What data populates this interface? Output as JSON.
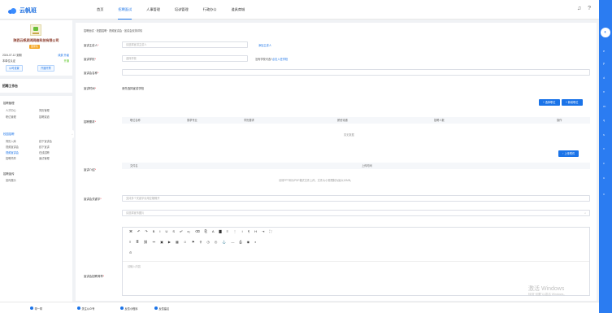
{
  "app": {
    "logo_text": "云帆班"
  },
  "nav": {
    "items": [
      "首页",
      "招聘面试",
      "人事管理",
      "培训管理",
      "行政办公",
      "道具商城"
    ]
  },
  "sidebar": {
    "company_name": "陕西云帆润鸿网络科技有限公司",
    "tag": "国家队",
    "date": "2024-07-12 到期",
    "date_actions": "续费 升级",
    "unit": "本单位认证",
    "unit_status": "开通",
    "btn_company": "公司设置",
    "btn_open": "开通开票",
    "workbench": "招聘工作台",
    "groups": [
      {
        "title": "招聘管理",
        "items": [
          "人才中心",
          "简历管理",
          "职位管理",
          "招聘渠道"
        ]
      },
      {
        "title": "校园招聘",
        "items": [
          "简历入库",
          "线下宣讲会",
          "视频宣讲会",
          "线下宣讲",
          "视频宣讲会",
          "在线招聘",
          "招聘简章",
          "面试管理"
        ]
      },
      {
        "title": "招聘宣传",
        "items": [
          "宣传展示"
        ]
      }
    ]
  },
  "main": {
    "breadcrumb": "招聘面试 · 校园招聘 · 视频宣讲会 · 宣讲会安排详情",
    "fields": {
      "host_label": "宣讲主讲人",
      "host_placeholder": "请选择宣讲主讲人",
      "host_link": "添加主讲人",
      "school_label": "宣讲学校",
      "school_placeholder": "选择学校",
      "school_hint": "没有学校可选?",
      "school_hint_link": "点击入驻学校",
      "name_label": "宣讲会名称",
      "time_label": "宣讲时间",
      "time_value": "请先选择宣讲学校",
      "recruit_label": "招聘需求",
      "intro_label": "宣讲介绍",
      "material_label": "宣讲会关键字",
      "material_placeholder": "支持多个关键字请用空格隔开",
      "attach_placeholder": "请选择宣传图片",
      "detail_label": "宣讲会招聘简章",
      "editor_placeholder": "请输入内容"
    },
    "buttons": {
      "choose": "+ 选择职位",
      "add": "+ 新增职位",
      "upload": "↑ 上传附件"
    },
    "recruit_table": {
      "columns": [
        "职位名称",
        "需求专业",
        "学历要求",
        "薪资待遇",
        "招聘人数",
        "操作"
      ],
      "empty": "暂无数据"
    },
    "attach_table": {
      "columns": [
        "文件名",
        "上传时间"
      ],
      "empty": "请将PPT和为PDF格式文件上传，文件大小需限制为最大10MB。"
    }
  },
  "footer": {
    "items": [
      "帮一帮",
      "关注公众号",
      "反馈小程序",
      "反馈建议"
    ]
  },
  "watermark": {
    "title": "激活 Windows",
    "sub": "转到\"设置\"以激活 Windows。"
  }
}
